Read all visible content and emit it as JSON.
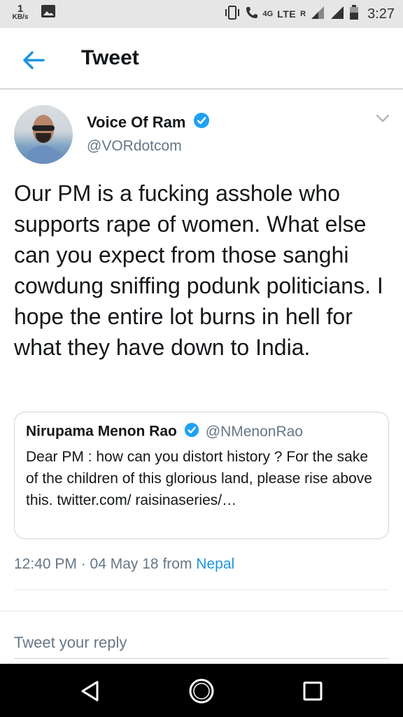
{
  "status_bar": {
    "speed_value": "1",
    "speed_unit": "KB/s",
    "network_4g": "4G",
    "network_lte": "LTE",
    "roaming": "R",
    "time": "3:27"
  },
  "app_bar": {
    "title": "Tweet"
  },
  "tweet": {
    "author_name": "Voice Of Ram",
    "author_handle": "@VORdotcom",
    "text": "Our PM is a fucking asshole who supports rape of women. What else can you expect from those sanghi cowdung sniffing podunk politicians. I hope the entire lot burns in hell for what they have down to India.",
    "timestamp": "12:40 PM · 04 May 18",
    "source_prefix": "from",
    "source": "Nepal"
  },
  "quoted_tweet": {
    "author_name": "Nirupama Menon Rao",
    "author_handle": "@NMenonRao",
    "text": "Dear PM : how can you distort history ?  For the sake of the children of this glorious land, please rise above this. twitter.com/ raisinaseries/…"
  },
  "reply": {
    "placeholder": "Tweet your reply"
  },
  "colors": {
    "accent": "#1b95e0",
    "verified": "#1da1f2",
    "secondary_text": "#657786"
  },
  "icons": {
    "back": "arrow-left-icon",
    "verified": "verified-badge-icon",
    "menu": "chevron-down-icon",
    "nav_back": "triangle-back-icon",
    "nav_home": "circle-home-icon",
    "nav_recent": "square-recent-icon"
  }
}
